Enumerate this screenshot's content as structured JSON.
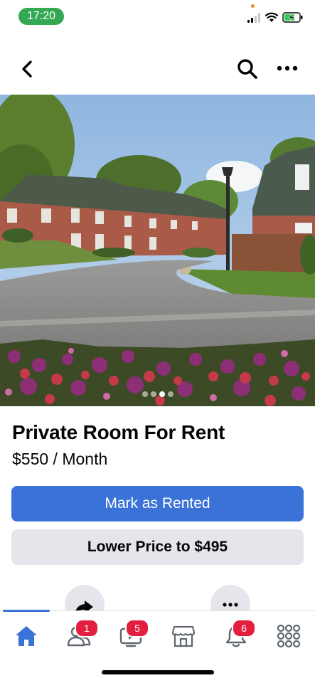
{
  "status_bar": {
    "time": "17:20"
  },
  "listing": {
    "title": "Private Room For Rent",
    "price": "$550 / Month",
    "photo_count": 4,
    "active_photo_index": 2
  },
  "actions": {
    "primary_label": "Mark as Rented",
    "secondary_label": "Lower Price to $495"
  },
  "tab_bar": {
    "tabs": [
      {
        "id": "home",
        "icon": "home-icon",
        "active": true,
        "badge": ""
      },
      {
        "id": "friends",
        "icon": "friends-icon",
        "active": false,
        "badge": "1"
      },
      {
        "id": "watch",
        "icon": "watch-icon",
        "active": false,
        "badge": "5"
      },
      {
        "id": "marketplace",
        "icon": "marketplace-icon",
        "active": false,
        "badge": ""
      },
      {
        "id": "notifications",
        "icon": "bell-icon",
        "active": false,
        "badge": "6"
      },
      {
        "id": "menu",
        "icon": "menu-grid-icon",
        "active": false,
        "badge": ""
      }
    ]
  },
  "colors": {
    "accent": "#3a72d8",
    "badge": "#e41e3f",
    "time_pill": "#34a853",
    "secondary_button": "#e4e6eb"
  }
}
